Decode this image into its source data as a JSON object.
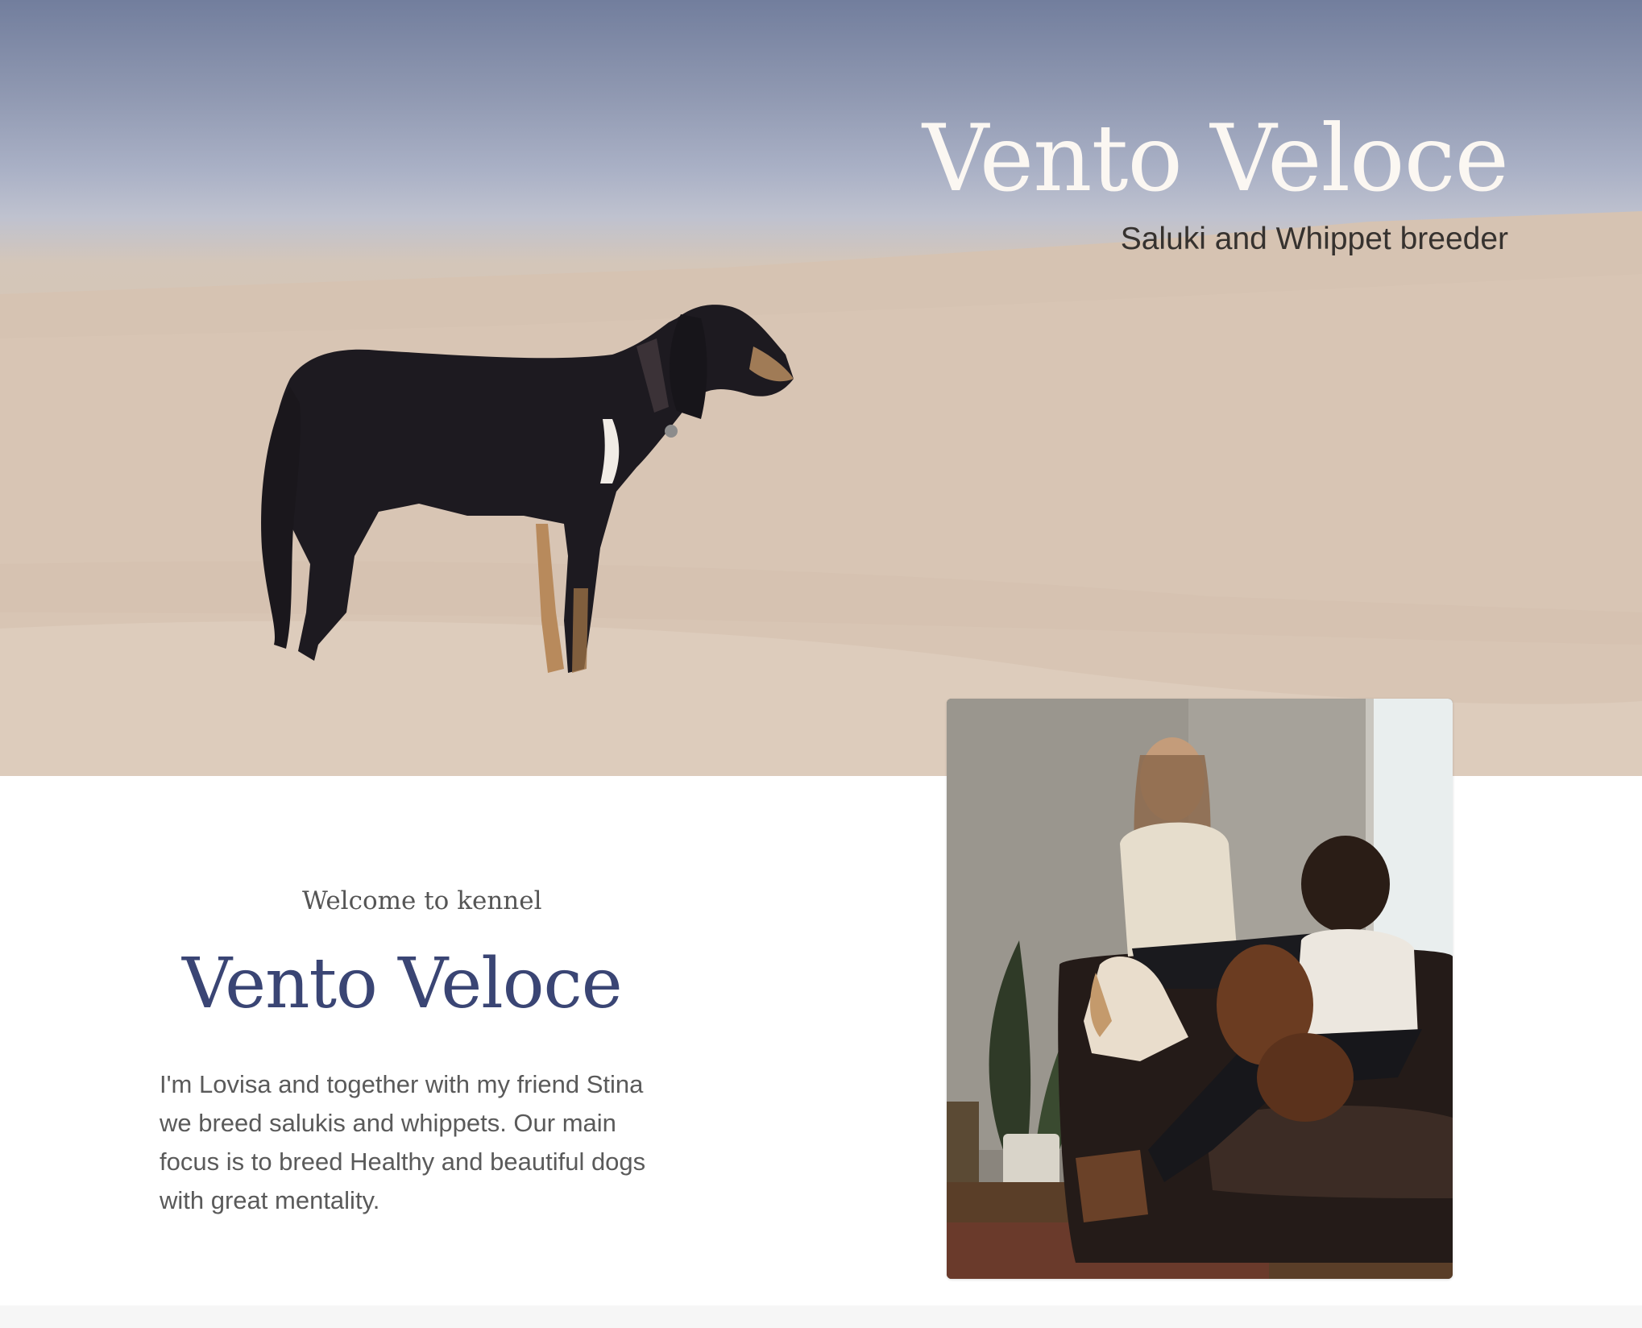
{
  "hero": {
    "title": "Vento Veloce",
    "subtitle": "Saluki and Whippet breeder",
    "image_subject": "saluki-dog-on-desert-dune"
  },
  "intro": {
    "eyebrow": "Welcome to kennel",
    "title": "Vento Veloce",
    "body": "I'm Lovisa and together with my friend Stina we breed salukis and whippets. Our main focus is to breed Healthy and beautiful dogs with great mentality."
  },
  "photo": {
    "subject": "two-women-with-dogs-on-leather-sofa"
  },
  "colors": {
    "title_accent": "#3a4574",
    "hero_title": "#fbf7f2",
    "body_text": "#5a5a5a"
  }
}
